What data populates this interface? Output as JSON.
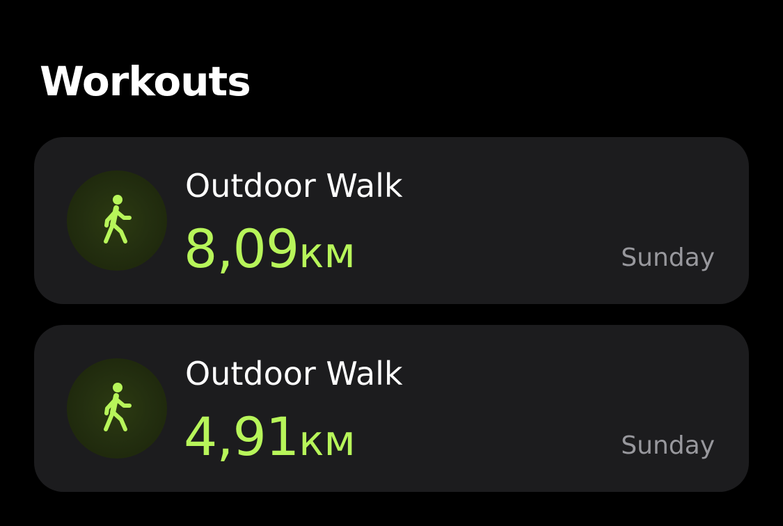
{
  "section": {
    "title": "Workouts"
  },
  "workouts": [
    {
      "icon": "figure-walk-icon",
      "name": "Outdoor Walk",
      "distance_value": "8,09",
      "distance_unit": "км",
      "day": "Sunday"
    },
    {
      "icon": "figure-walk-icon",
      "name": "Outdoor Walk",
      "distance_value": "4,91",
      "distance_unit": "км",
      "day": "Sunday"
    }
  ],
  "colors": {
    "background": "#000000",
    "card": "#1c1c1e",
    "accent": "#b7f55a",
    "secondary_text": "#98989d",
    "icon_circle": "#222d0f"
  }
}
